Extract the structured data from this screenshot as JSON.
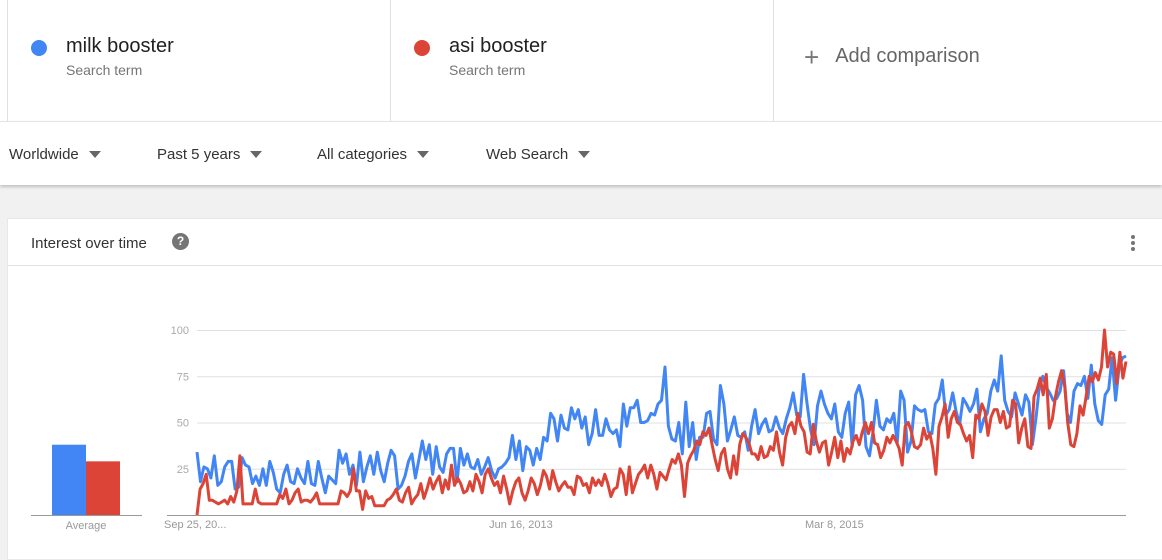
{
  "terms": [
    {
      "name": "milk booster",
      "subtitle": "Search term",
      "color": "#4285f4"
    },
    {
      "name": "asi booster",
      "subtitle": "Search term",
      "color": "#db4437"
    }
  ],
  "add_comparison": {
    "icon": "plus-icon",
    "label": "Add comparison"
  },
  "filters": [
    {
      "label": "Worldwide"
    },
    {
      "label": "Past 5 years"
    },
    {
      "label": "All categories"
    },
    {
      "label": "Web Search"
    }
  ],
  "card": {
    "title": "Interest over time",
    "help_icon": "?",
    "menu_icon": "more-vert-icon"
  },
  "chart_data": [
    {
      "type": "bar",
      "title": "Average",
      "categories": [
        "Average"
      ],
      "series": [
        {
          "name": "milk booster",
          "values": [
            38
          ]
        },
        {
          "name": "asi booster",
          "values": [
            29
          ]
        }
      ],
      "xlabel": "Average",
      "ylim": [
        0,
        100
      ]
    },
    {
      "type": "line",
      "title": "Interest over time",
      "ylim": [
        0,
        100
      ],
      "yticks": [
        25,
        50,
        75,
        100
      ],
      "xtick_labels": [
        "Sep 25, 20...",
        "Jun 16, 2013",
        "Mar 8, 2015"
      ],
      "xtick_positions": [
        0,
        0.35,
        0.69
      ],
      "grid": true,
      "series": [
        {
          "name": "milk booster",
          "color": "#4285f4",
          "values": [
            34,
            18,
            26,
            25,
            20,
            32,
            16,
            18,
            26,
            29,
            29,
            14,
            15,
            31,
            27,
            26,
            17,
            21,
            16,
            25,
            16,
            29,
            23,
            14,
            12,
            22,
            27,
            18,
            17,
            25,
            20,
            17,
            29,
            17,
            16,
            29,
            20,
            12,
            21,
            19,
            17,
            35,
            28,
            33,
            22,
            27,
            16,
            34,
            18,
            26,
            32,
            22,
            34,
            24,
            18,
            28,
            35,
            32,
            14,
            16,
            21,
            29,
            33,
            20,
            30,
            40,
            30,
            38,
            22,
            37,
            26,
            23,
            33,
            36,
            36,
            18,
            36,
            27,
            33,
            26,
            25,
            30,
            22,
            26,
            31,
            24,
            20,
            25,
            26,
            28,
            31,
            43,
            30,
            40,
            24,
            37,
            35,
            27,
            36,
            30,
            42,
            40,
            55,
            52,
            40,
            54,
            47,
            46,
            58,
            52,
            57,
            47,
            53,
            38,
            44,
            57,
            43,
            43,
            52,
            46,
            44,
            46,
            37,
            60,
            48,
            58,
            58,
            62,
            50,
            50,
            51,
            55,
            54,
            60,
            62,
            80,
            48,
            41,
            40,
            50,
            33,
            61,
            37,
            50,
            30,
            42,
            42,
            55,
            56,
            41,
            38,
            70,
            60,
            40,
            46,
            53,
            43,
            42,
            45,
            35,
            48,
            57,
            44,
            49,
            52,
            45,
            46,
            53,
            47,
            44,
            52,
            58,
            66,
            54,
            53,
            76,
            60,
            46,
            38,
            59,
            67,
            60,
            55,
            52,
            60,
            45,
            42,
            55,
            61,
            37,
            65,
            70,
            62,
            37,
            32,
            45,
            62,
            48,
            46,
            52,
            50,
            55,
            39,
            67,
            62,
            34,
            40,
            59,
            57,
            56,
            57,
            45,
            44,
            60,
            63,
            73,
            54,
            57,
            66,
            56,
            49,
            63,
            60,
            56,
            60,
            68,
            45,
            52,
            55,
            67,
            73,
            67,
            86,
            62,
            56,
            53,
            66,
            60,
            54,
            65,
            61,
            38,
            52,
            69,
            75,
            69,
            66,
            62,
            63,
            67,
            78,
            55,
            50,
            67,
            71,
            70,
            75,
            63,
            81,
            60,
            51,
            49,
            65,
            68,
            85,
            62,
            80,
            85,
            86
          ]
        },
        {
          "name": "asi booster",
          "color": "#db4437",
          "values": [
            0,
            14,
            17,
            22,
            8,
            8,
            7,
            6,
            7,
            8,
            6,
            10,
            7,
            13,
            32,
            6,
            6,
            6,
            6,
            14,
            7,
            6,
            6,
            6,
            6,
            6,
            6,
            11,
            9,
            14,
            6,
            8,
            12,
            14,
            7,
            8,
            8,
            7,
            9,
            12,
            6,
            6,
            6,
            6,
            6,
            6,
            6,
            13,
            12,
            10,
            13,
            25,
            13,
            13,
            3,
            13,
            9,
            10,
            5,
            5,
            5,
            5,
            8,
            9,
            11,
            14,
            8,
            7,
            12,
            15,
            6,
            9,
            11,
            17,
            9,
            14,
            20,
            14,
            18,
            21,
            12,
            19,
            14,
            27,
            16,
            20,
            17,
            12,
            13,
            18,
            13,
            22,
            18,
            12,
            22,
            25,
            20,
            16,
            18,
            12,
            21,
            14,
            6,
            13,
            18,
            20,
            12,
            8,
            13,
            20,
            17,
            11,
            16,
            24,
            21,
            14,
            24,
            18,
            13,
            16,
            18,
            15,
            15,
            11,
            21,
            20,
            16,
            17,
            12,
            20,
            16,
            19,
            16,
            22,
            17,
            10,
            14,
            15,
            25,
            22,
            11,
            26,
            12,
            17,
            22,
            24,
            27,
            20,
            27,
            22,
            14,
            23,
            21,
            19,
            25,
            30,
            28,
            33,
            27,
            10,
            28,
            32,
            35,
            40,
            38,
            45,
            43,
            47,
            38,
            30,
            24,
            33,
            36,
            25,
            20,
            32,
            22,
            38,
            44,
            42,
            39,
            33,
            33,
            30,
            37,
            31,
            32,
            37,
            35,
            45,
            34,
            27,
            42,
            48,
            50,
            44,
            55,
            48,
            45,
            34,
            33,
            49,
            40,
            34,
            39,
            40,
            27,
            34,
            42,
            31,
            40,
            29,
            36,
            33,
            40,
            43,
            38,
            45,
            50,
            44,
            50,
            39,
            38,
            31,
            35,
            42,
            39,
            43,
            40,
            36,
            27,
            48,
            50,
            45,
            37,
            36,
            38,
            47,
            41,
            44,
            36,
            22,
            48,
            53,
            60,
            42,
            52,
            56,
            50,
            49,
            44,
            40,
            43,
            31,
            54,
            52,
            60,
            56,
            43,
            53,
            57,
            57,
            50,
            56,
            47,
            48,
            62,
            60,
            39,
            47,
            52,
            37,
            36,
            64,
            68,
            74,
            65,
            76,
            47,
            52,
            64,
            72,
            78,
            70,
            50,
            38,
            37,
            44,
            59,
            54,
            64,
            75,
            72,
            77,
            73,
            80,
            100,
            80,
            88,
            87,
            71,
            88,
            74,
            83
          ]
        }
      ]
    }
  ]
}
